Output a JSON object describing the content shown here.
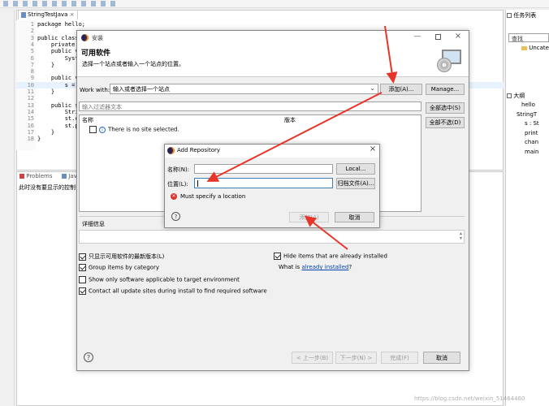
{
  "editor": {
    "tab_label": "StringTestJava",
    "lines": [
      {
        "n": "1",
        "text": "package hello;"
      },
      {
        "n": "2",
        "text": ""
      },
      {
        "n": "3",
        "text": "public class"
      },
      {
        "n": "4",
        "text": "    private S"
      },
      {
        "n": "5",
        "text": "    public vo"
      },
      {
        "n": "6",
        "text": "        Syste"
      },
      {
        "n": "7",
        "text": "    }"
      },
      {
        "n": "8",
        "text": ""
      },
      {
        "n": "9",
        "text": "    public vo"
      },
      {
        "n": "10",
        "text": "        s = "
      },
      {
        "n": "11",
        "text": "    }"
      },
      {
        "n": "12",
        "text": ""
      },
      {
        "n": "13",
        "text": "    public st"
      },
      {
        "n": "14",
        "text": "        String"
      },
      {
        "n": "15",
        "text": "        st.cha"
      },
      {
        "n": "16",
        "text": "        st.pri"
      },
      {
        "n": "17",
        "text": "    }"
      },
      {
        "n": "18",
        "text": "}"
      }
    ]
  },
  "bottom_panel": {
    "tab_problems": "Problems",
    "tab_java": "Java",
    "console_text": "此时没有要显示的控制台"
  },
  "right_panel": {
    "tasks_title": "任务列表",
    "find_placeholder": "查找",
    "uncate": "Uncate",
    "outline_title": "大纲",
    "outline_items": [
      "hello",
      "StringT",
      "s : St",
      "print",
      "chan",
      "main"
    ]
  },
  "install_dialog": {
    "window_title": "安装",
    "header_title": "可用软件",
    "header_subtitle": "选择一个站点或者输入一个站点的位置。",
    "work_with_label": "Work with:",
    "work_with_value": "输入或者选择一个站点",
    "add_button": "添加(A)...",
    "manage_button": "Manage...",
    "filter_placeholder": "输入过滤器文本",
    "select_all_button": "全部选中(S)",
    "deselect_all_button": "全部不选(D)",
    "col_name": "名称",
    "col_version": "版本",
    "no_site_text": "There is no site selected.",
    "details_label": "详细信息",
    "options": [
      {
        "label": "只显示可用软件的最新版本(L)",
        "checked": true
      },
      {
        "label": "Group items by category",
        "checked": true
      },
      {
        "label": "Show only software applicable to target environment",
        "checked": false
      },
      {
        "label": "Contact all update sites during install to find required software",
        "checked": true
      }
    ],
    "hide_installed_label": "Hide items that are already installed",
    "hide_installed_checked": true,
    "what_is_prefix": "What is ",
    "what_is_link": "already installed",
    "what_is_suffix": "?",
    "back_button": "< 上一步(B)",
    "next_button": "下一步(N) >",
    "finish_button": "完成(F)",
    "cancel_button": "取消"
  },
  "repo_dialog": {
    "title": "Add Repository",
    "name_label": "名称(N):",
    "name_value": "",
    "local_button": "Local...",
    "location_label": "位置(L):",
    "location_value": "",
    "archive_button": "归档文件(A)...",
    "error_text": "Must specify a location",
    "add_button": "添加(A)",
    "cancel_button": "取消"
  },
  "watermark": "https://blog.csdn.net/weixin_51464460",
  "colors": {
    "arrow": "#e8352a",
    "focus_border": "#3c7fb1",
    "link": "#0645ad",
    "error": "#d9342b"
  }
}
